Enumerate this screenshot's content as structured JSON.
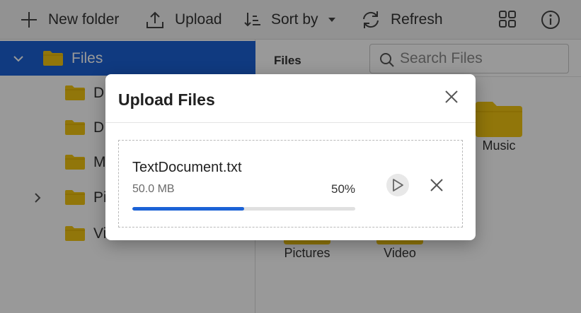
{
  "toolbar": {
    "new_folder_label": "New folder",
    "upload_label": "Upload",
    "sort_label": "Sort by",
    "refresh_label": "Refresh"
  },
  "nav": {
    "root_label": "Files",
    "items": [
      {
        "label": "D"
      },
      {
        "label": "D"
      },
      {
        "label": "M"
      },
      {
        "label": "Pi"
      },
      {
        "label": "Vi"
      }
    ]
  },
  "content": {
    "breadcrumb": "Files",
    "search_placeholder": "Search Files",
    "tiles": [
      {
        "label": "Music"
      },
      {
        "label": "Pictures"
      },
      {
        "label": "Video"
      }
    ]
  },
  "dialog": {
    "title": "Upload Files",
    "file": {
      "name": "TextDocument.txt",
      "size": "50.0 MB",
      "percent_label": "50%",
      "progress": 0.5
    }
  },
  "colors": {
    "accent": "#1b62d6",
    "folder": "#f2c511",
    "toolbar_bg": "#f3f3f3"
  }
}
